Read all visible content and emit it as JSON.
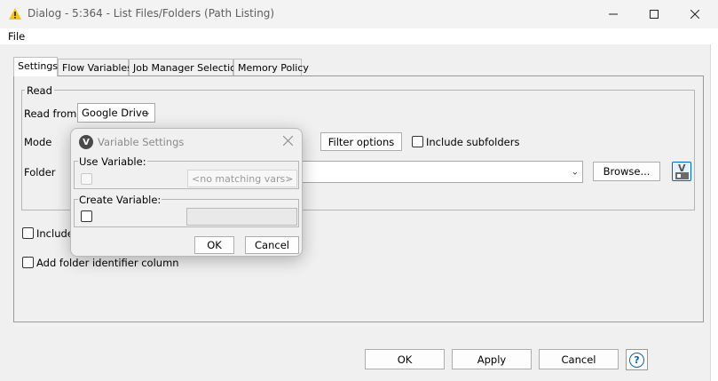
{
  "window": {
    "title": "Dialog - 5:364 - List Files/Folders (Path Listing)",
    "minimize_icon": "minimize-icon",
    "maximize_icon": "maximize-icon",
    "close_icon": "close-icon"
  },
  "menu": {
    "file": "File"
  },
  "tabs": [
    {
      "label": "Settings",
      "active": true
    },
    {
      "label": "Flow Variables",
      "active": false
    },
    {
      "label": "Job Manager Selection",
      "active": false
    },
    {
      "label": "Memory Policy",
      "active": false
    }
  ],
  "read_group": {
    "legend": "Read",
    "read_from_label": "Read from",
    "read_from_value": "Google Drive",
    "mode_label": "Mode",
    "filter_options_button": "Filter options",
    "include_subfolders_label": "Include subfolders",
    "folder_label": "Folder",
    "folder_value": "",
    "browse_button": "Browse...",
    "variable_button_letter": "V"
  },
  "options": {
    "include_label": "Include",
    "add_folder_id_label": "Add folder identifier column"
  },
  "popup": {
    "title": "Variable Settings",
    "icon_letter": "V",
    "use_variable_label": "Use Variable:",
    "use_variable_select": "<no matching vars>",
    "create_variable_label": "Create Variable:",
    "create_variable_value": "",
    "ok": "OK",
    "cancel": "Cancel"
  },
  "footer": {
    "ok": "OK",
    "apply": "Apply",
    "cancel": "Cancel",
    "help_symbol": "?"
  },
  "colors": {
    "accent": "#0067c0",
    "warning_triangle": "#f5c518"
  }
}
